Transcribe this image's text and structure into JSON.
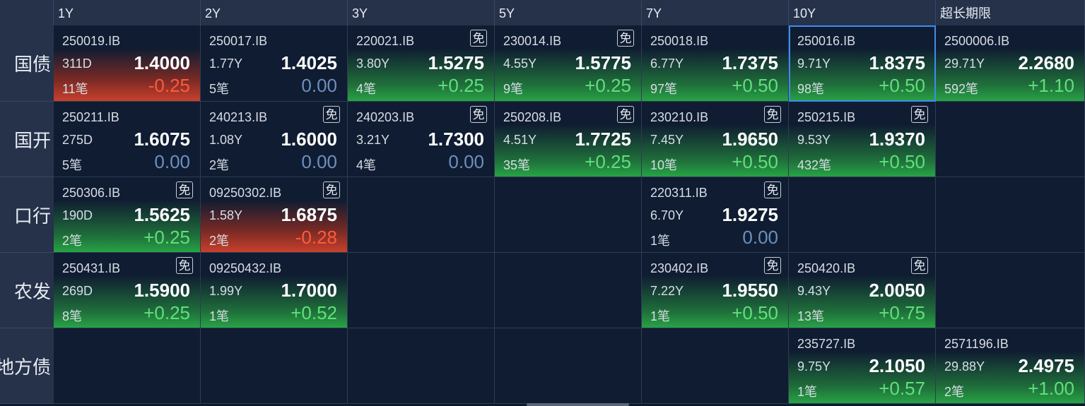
{
  "columns": [
    "1Y",
    "2Y",
    "3Y",
    "5Y",
    "7Y",
    "10Y",
    "超长期限"
  ],
  "rows": [
    {
      "label": "国债",
      "cells": [
        {
          "code": "250019.IB",
          "term": "311D",
          "yield": "1.4000",
          "count": "11笔",
          "change": "-0.25",
          "trend": "down",
          "mian": false
        },
        {
          "code": "250017.IB",
          "term": "1.77Y",
          "yield": "1.4025",
          "count": "5笔",
          "change": "0.00",
          "trend": "flat",
          "mian": false
        },
        {
          "code": "220021.IB",
          "term": "3.80Y",
          "yield": "1.5275",
          "count": "4笔",
          "change": "+0.25",
          "trend": "up",
          "mian": true
        },
        {
          "code": "230014.IB",
          "term": "4.55Y",
          "yield": "1.5775",
          "count": "9笔",
          "change": "+0.25",
          "trend": "up",
          "mian": true
        },
        {
          "code": "250018.IB",
          "term": "6.77Y",
          "yield": "1.7375",
          "count": "97笔",
          "change": "+0.50",
          "trend": "up",
          "mian": false
        },
        {
          "code": "250016.IB",
          "term": "9.71Y",
          "yield": "1.8375",
          "count": "98笔",
          "change": "+0.50",
          "trend": "up",
          "mian": false,
          "selected": true
        },
        {
          "code": "2500006.IB",
          "term": "29.71Y",
          "yield": "2.2680",
          "count": "592笔",
          "change": "+1.10",
          "trend": "up",
          "mian": false
        }
      ]
    },
    {
      "label": "国开",
      "cells": [
        {
          "code": "250211.IB",
          "term": "275D",
          "yield": "1.6075",
          "count": "5笔",
          "change": "0.00",
          "trend": "flat",
          "mian": false
        },
        {
          "code": "240213.IB",
          "term": "1.08Y",
          "yield": "1.6000",
          "count": "2笔",
          "change": "0.00",
          "trend": "flat",
          "mian": true
        },
        {
          "code": "240203.IB",
          "term": "3.21Y",
          "yield": "1.7300",
          "count": "4笔",
          "change": "0.00",
          "trend": "flat",
          "mian": true
        },
        {
          "code": "250208.IB",
          "term": "4.51Y",
          "yield": "1.7725",
          "count": "35笔",
          "change": "+0.25",
          "trend": "up",
          "mian": true
        },
        {
          "code": "230210.IB",
          "term": "7.45Y",
          "yield": "1.9650",
          "count": "10笔",
          "change": "+0.50",
          "trend": "up",
          "mian": true
        },
        {
          "code": "250215.IB",
          "term": "9.53Y",
          "yield": "1.9370",
          "count": "432笔",
          "change": "+0.50",
          "trend": "up",
          "mian": true
        },
        null
      ]
    },
    {
      "label": "口行",
      "cells": [
        {
          "code": "250306.IB",
          "term": "190D",
          "yield": "1.5625",
          "count": "2笔",
          "change": "+0.25",
          "trend": "up",
          "mian": true
        },
        {
          "code": "09250302.IB",
          "term": "1.58Y",
          "yield": "1.6875",
          "count": "2笔",
          "change": "-0.28",
          "trend": "down",
          "mian": true
        },
        null,
        null,
        {
          "code": "220311.IB",
          "term": "6.70Y",
          "yield": "1.9275",
          "count": "1笔",
          "change": "0.00",
          "trend": "flat",
          "mian": true
        },
        null,
        null
      ]
    },
    {
      "label": "农发",
      "cells": [
        {
          "code": "250431.IB",
          "term": "269D",
          "yield": "1.5900",
          "count": "8笔",
          "change": "+0.25",
          "trend": "up",
          "mian": true
        },
        {
          "code": "09250432.IB",
          "term": "1.99Y",
          "yield": "1.7000",
          "count": "1笔",
          "change": "+0.52",
          "trend": "up",
          "mian": false
        },
        null,
        null,
        {
          "code": "230402.IB",
          "term": "7.22Y",
          "yield": "1.9550",
          "count": "1笔",
          "change": "+0.50",
          "trend": "up",
          "mian": true
        },
        {
          "code": "250420.IB",
          "term": "9.43Y",
          "yield": "2.0050",
          "count": "13笔",
          "change": "+0.75",
          "trend": "up",
          "mian": true
        },
        null
      ]
    },
    {
      "label": "地方债",
      "cells": [
        null,
        null,
        null,
        null,
        null,
        {
          "code": "235727.IB",
          "term": "9.75Y",
          "yield": "2.1050",
          "count": "1笔",
          "change": "+0.57",
          "trend": "up",
          "mian": false
        },
        {
          "code": "2571196.IB",
          "term": "29.88Y",
          "yield": "2.4975",
          "count": "2笔",
          "change": "+1.00",
          "trend": "up",
          "mian": false
        }
      ]
    }
  ],
  "mian_label": "免",
  "colors": {
    "up": "#27a345",
    "down": "#c9402c",
    "flat": "#6d8fbf",
    "selected_border": "#3c8cf0",
    "background": "#0d1a2e"
  }
}
